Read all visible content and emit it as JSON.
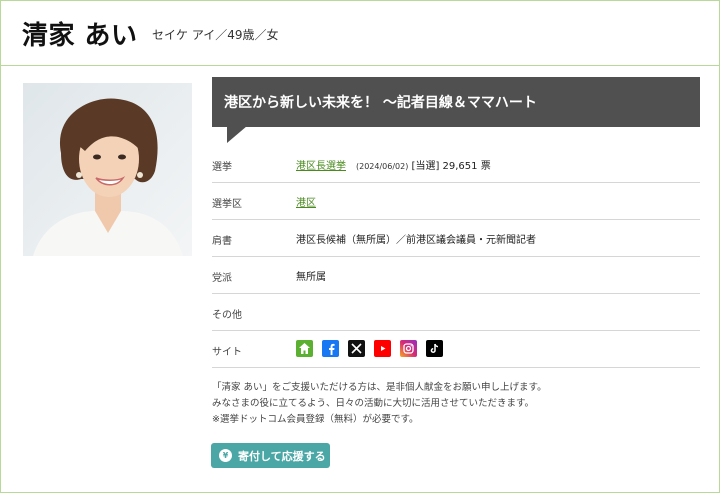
{
  "profile": {
    "name": "清家 あい",
    "kana_age_gender": "セイケ アイ／49歳／女"
  },
  "catchphrase": "港区から新しい未来を！ 〜記者目線＆ママハート",
  "details": {
    "election_label": "選挙",
    "election_link": "港区長選挙",
    "election_date": "(2024/06/02)",
    "election_result": "[当選] 29,651 票",
    "district_label": "選挙区",
    "district_link": "港区",
    "title_label": "肩書",
    "title_value": "港区長候補（無所属）／前港区議会議員・元新聞記者",
    "party_label": "党派",
    "party_value": "無所属",
    "other_label": "その他",
    "other_value": "",
    "site_label": "サイト"
  },
  "site_icons": [
    {
      "name": "home-icon",
      "color": "#5cb031"
    },
    {
      "name": "facebook-icon",
      "color": "#1877f2"
    },
    {
      "name": "x-icon",
      "color": "#111111"
    },
    {
      "name": "youtube-icon",
      "color": "#ff0000"
    },
    {
      "name": "instagram-icon",
      "color": "#d62976"
    },
    {
      "name": "tiktok-icon",
      "color": "#000000"
    }
  ],
  "support_note": {
    "line1": "「清家 あい」をご支援いただける方は、是非個人献金をお願い申し上げます。",
    "line2": "みなさまの役に立てるよう、日々の活動に大切に活用させていただきます。",
    "line3": "※選挙ドットコム会員登録（無料）が必要です。"
  },
  "donate_button": {
    "icon_char": "¥",
    "label": "寄付して応援する"
  },
  "colors": {
    "border": "#b9d99a",
    "link": "#4a8a1f",
    "banner": "#505050",
    "button": "#4aa7a5"
  }
}
